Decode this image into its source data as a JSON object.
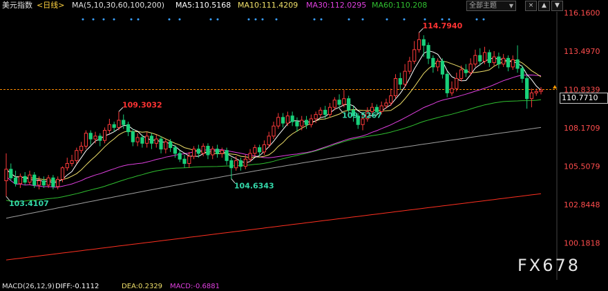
{
  "header": {
    "symbol": "美元指数",
    "period": "<日线>",
    "ma_label": "MA(5,10,30,60,100,200)",
    "ma5": "MA5:110.5168",
    "ma10": "MA10:111.4209",
    "ma30": "MA30:112.0295",
    "ma60": "MA60:110.208",
    "theme_select": "全部主题",
    "theme_arrow": "▼",
    "btn_close": "×",
    "btn_up": "▲",
    "btn_down": "▼"
  },
  "current_price": "110.7710",
  "watermark": "FX678",
  "macd": {
    "label": "MACD(26,12,9)",
    "dif": "DIFF:-0.1112",
    "dea": "DEA:0.2329",
    "macd": "MACD:-0.6881"
  },
  "colors": {
    "up": "#ff3b3b",
    "down": "#19d07a",
    "ma5": "#ffffff",
    "ma10": "#f0e06a",
    "ma30": "#e040e0",
    "ma60": "#30c030",
    "ma100": "#a0a0a0",
    "ma200": "#ff3020",
    "axis_text": "#ff4d4d",
    "dashed_line": "#ff8c00"
  },
  "chart_data": {
    "type": "candlestick",
    "title": "",
    "y_axis_labels": [
      "116.1600",
      "113.4970",
      "110.8339",
      "108.1709",
      "105.5079",
      "102.8448",
      "100.1818"
    ],
    "ylim": [
      98.5,
      117.0
    ],
    "reference_price": 110.8339,
    "annotations": [
      {
        "text": "114.7940",
        "value": 114.794,
        "type": "high"
      },
      {
        "text": "109.3032",
        "value": 109.3032,
        "type": "high"
      },
      {
        "text": "104.6343",
        "value": 104.6343,
        "type": "low"
      },
      {
        "text": "103.4107",
        "value": 103.4107,
        "type": "low"
      },
      {
        "text": "109.5267",
        "value": 109.5267,
        "type": "low"
      }
    ],
    "candles": [
      [
        104.5,
        105.3,
        106.4,
        103.4
      ],
      [
        105.3,
        104.7,
        105.7,
        104.5
      ],
      [
        104.7,
        104.3,
        105.2,
        104.1
      ],
      [
        104.3,
        104.8,
        105.0,
        104.0
      ],
      [
        104.8,
        104.4,
        105.1,
        104.2
      ],
      [
        104.4,
        104.9,
        105.2,
        104.2
      ],
      [
        104.9,
        104.2,
        105.1,
        104.0
      ],
      [
        104.2,
        104.5,
        104.8,
        103.9
      ],
      [
        104.5,
        104.2,
        104.8,
        104.0
      ],
      [
        104.2,
        104.7,
        104.9,
        104.0
      ],
      [
        104.7,
        104.1,
        104.9,
        103.9
      ],
      [
        104.1,
        104.6,
        104.8,
        103.9
      ],
      [
        104.6,
        105.4,
        105.5,
        104.4
      ],
      [
        105.4,
        105.7,
        106.1,
        105.2
      ],
      [
        105.7,
        105.9,
        106.3,
        105.5
      ],
      [
        105.9,
        106.6,
        106.8,
        105.7
      ],
      [
        106.6,
        106.9,
        107.2,
        106.4
      ],
      [
        106.9,
        107.8,
        108.0,
        106.7
      ],
      [
        107.8,
        107.4,
        108.0,
        107.0
      ],
      [
        107.4,
        107.6,
        107.9,
        107.1
      ],
      [
        107.6,
        107.3,
        107.8,
        106.9
      ],
      [
        107.3,
        108.0,
        108.2,
        107.1
      ],
      [
        108.0,
        108.4,
        108.8,
        107.8
      ],
      [
        108.4,
        108.2,
        108.6,
        107.9
      ],
      [
        108.2,
        108.7,
        109.3,
        108.0
      ],
      [
        108.7,
        108.4,
        109.1,
        108.1
      ],
      [
        108.4,
        107.9,
        108.6,
        107.6
      ],
      [
        107.9,
        107.2,
        108.1,
        106.9
      ],
      [
        107.2,
        107.5,
        107.8,
        106.9
      ],
      [
        107.5,
        107.1,
        107.7,
        106.8
      ],
      [
        107.1,
        107.6,
        107.9,
        106.8
      ],
      [
        107.6,
        107.1,
        107.8,
        106.7
      ],
      [
        107.1,
        107.4,
        107.7,
        106.8
      ],
      [
        107.4,
        106.7,
        107.6,
        106.4
      ],
      [
        106.7,
        107.2,
        107.4,
        106.4
      ],
      [
        107.2,
        106.8,
        107.4,
        106.5
      ],
      [
        106.8,
        106.4,
        107.0,
        106.1
      ],
      [
        106.4,
        106.0,
        106.6,
        105.8
      ],
      [
        106.0,
        105.7,
        106.3,
        105.4
      ],
      [
        105.7,
        106.2,
        106.5,
        105.4
      ],
      [
        106.2,
        106.7,
        106.9,
        106.0
      ],
      [
        106.7,
        106.4,
        107.0,
        106.1
      ],
      [
        106.4,
        106.9,
        107.1,
        106.2
      ],
      [
        106.9,
        106.3,
        107.1,
        106.0
      ],
      [
        106.3,
        106.7,
        106.9,
        106.0
      ],
      [
        106.7,
        106.4,
        107.0,
        106.1
      ],
      [
        106.4,
        106.6,
        106.8,
        106.1
      ],
      [
        106.6,
        105.9,
        106.8,
        105.6
      ],
      [
        105.9,
        105.4,
        106.1,
        104.6
      ],
      [
        105.4,
        105.9,
        106.2,
        105.2
      ],
      [
        105.9,
        105.5,
        106.1,
        105.2
      ],
      [
        105.5,
        106.0,
        106.3,
        105.3
      ],
      [
        106.0,
        106.4,
        106.7,
        105.8
      ],
      [
        106.4,
        106.8,
        107.0,
        106.2
      ],
      [
        106.8,
        106.5,
        107.0,
        106.2
      ],
      [
        106.5,
        107.0,
        107.3,
        106.3
      ],
      [
        107.0,
        107.6,
        107.9,
        106.8
      ],
      [
        107.6,
        108.3,
        108.6,
        107.4
      ],
      [
        108.3,
        108.9,
        109.2,
        108.1
      ],
      [
        108.9,
        108.5,
        109.2,
        108.2
      ],
      [
        108.5,
        109.0,
        109.3,
        108.3
      ],
      [
        109.0,
        108.6,
        109.3,
        108.3
      ],
      [
        108.6,
        108.3,
        108.9,
        107.9
      ],
      [
        108.3,
        108.7,
        109.0,
        108.0
      ],
      [
        108.7,
        108.4,
        109.0,
        108.1
      ],
      [
        108.4,
        108.8,
        109.1,
        108.2
      ],
      [
        108.8,
        109.1,
        109.3,
        108.5
      ],
      [
        109.1,
        109.4,
        109.6,
        108.9
      ],
      [
        109.4,
        109.1,
        109.7,
        108.8
      ],
      [
        109.1,
        109.6,
        109.9,
        108.9
      ],
      [
        109.6,
        110.1,
        110.3,
        109.4
      ],
      [
        110.1,
        109.8,
        110.5,
        109.5
      ],
      [
        109.8,
        110.2,
        110.8,
        109.6
      ],
      [
        110.2,
        109.4,
        110.4,
        109.1
      ],
      [
        109.4,
        109.0,
        109.7,
        108.6
      ],
      [
        109.0,
        108.4,
        109.2,
        108.1
      ],
      [
        108.4,
        108.8,
        109.1,
        108.0
      ],
      [
        108.8,
        109.3,
        109.6,
        108.6
      ],
      [
        109.3,
        109.6,
        109.9,
        109.1
      ],
      [
        109.6,
        109.3,
        109.8,
        109.0
      ],
      [
        109.3,
        109.7,
        110.0,
        109.1
      ],
      [
        109.7,
        109.9,
        110.2,
        109.5
      ],
      [
        109.9,
        110.4,
        110.9,
        109.7
      ],
      [
        110.4,
        111.6,
        111.9,
        110.2
      ],
      [
        111.6,
        111.2,
        112.0,
        110.8
      ],
      [
        111.2,
        112.1,
        112.6,
        111.0
      ],
      [
        112.1,
        112.8,
        113.1,
        111.9
      ],
      [
        112.8,
        113.6,
        114.2,
        112.6
      ],
      [
        113.6,
        114.3,
        114.8,
        113.4
      ],
      [
        114.3,
        113.9,
        114.6,
        113.1
      ],
      [
        113.9,
        113.0,
        114.1,
        112.6
      ],
      [
        113.0,
        112.4,
        113.2,
        112.0
      ],
      [
        112.4,
        112.8,
        113.0,
        112.1
      ],
      [
        112.8,
        111.9,
        113.0,
        111.6
      ],
      [
        111.9,
        110.6,
        112.1,
        110.3
      ],
      [
        110.6,
        110.9,
        111.4,
        110.4
      ],
      [
        110.9,
        111.6,
        112.0,
        110.7
      ],
      [
        111.6,
        112.2,
        112.5,
        111.4
      ],
      [
        112.2,
        112.0,
        112.6,
        111.7
      ],
      [
        112.0,
        112.6,
        113.0,
        111.8
      ],
      [
        112.6,
        113.2,
        113.6,
        112.4
      ],
      [
        113.2,
        112.8,
        113.7,
        112.5
      ],
      [
        112.8,
        113.4,
        113.8,
        112.6
      ],
      [
        113.4,
        112.7,
        113.6,
        112.4
      ],
      [
        112.7,
        113.1,
        113.5,
        112.5
      ],
      [
        113.1,
        112.6,
        113.4,
        112.3
      ],
      [
        112.6,
        113.0,
        113.3,
        112.4
      ],
      [
        113.0,
        112.4,
        113.2,
        112.1
      ],
      [
        112.4,
        112.9,
        113.2,
        112.2
      ],
      [
        112.9,
        112.3,
        113.9,
        112.0
      ],
      [
        112.3,
        111.6,
        112.5,
        111.3
      ],
      [
        111.6,
        110.2,
        111.8,
        109.5
      ],
      [
        110.2,
        110.6,
        110.9,
        109.6
      ],
      [
        110.6,
        110.7,
        110.9,
        110.4
      ],
      [
        110.7,
        110.8,
        111.0,
        110.5
      ]
    ]
  }
}
